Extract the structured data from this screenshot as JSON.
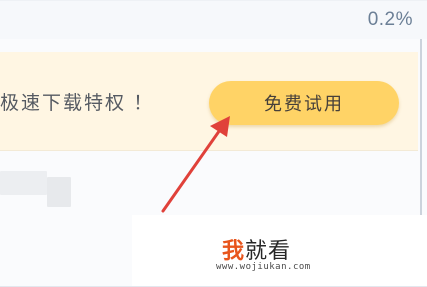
{
  "status": {
    "progress_text": "0.2%"
  },
  "promo": {
    "message": "极速下载特权 ！",
    "trial_button_label": "免费试用"
  },
  "annotation": {
    "arrow_color": "#e0413a",
    "icon": "arrow-icon"
  },
  "watermark": {
    "title_first": "我",
    "title_rest": "就看",
    "url": "www.wojiukan.com",
    "accent_color": "#e8551c"
  }
}
